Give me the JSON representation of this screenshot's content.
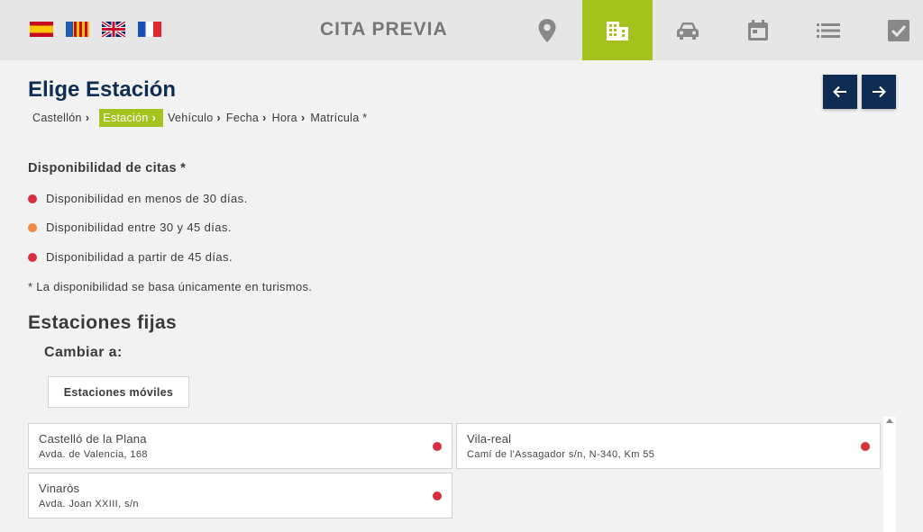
{
  "header": {
    "title": "CITA PREVIA",
    "languages": [
      {
        "code": "es",
        "icon": "spain-flag-icon"
      },
      {
        "code": "va",
        "icon": "valencia-flag-icon"
      },
      {
        "code": "en",
        "icon": "uk-flag-icon"
      },
      {
        "code": "fr",
        "icon": "france-flag-icon"
      }
    ],
    "nav": [
      {
        "icon": "location-pin-icon",
        "active": false
      },
      {
        "icon": "building-icon",
        "active": true
      },
      {
        "icon": "car-icon",
        "active": false
      },
      {
        "icon": "calendar-icon",
        "active": false
      },
      {
        "icon": "list-icon",
        "active": false
      },
      {
        "icon": "checkbox-icon",
        "active": false
      }
    ]
  },
  "page": {
    "title": "Elige Estación"
  },
  "breadcrumb": {
    "items": [
      "Castellón",
      "Estación",
      "Vehículo",
      "Fecha",
      "Hora",
      "Matrícula *"
    ],
    "active_index": 1,
    "separator": "›"
  },
  "availability": {
    "title": "Disponibilidad de citas *",
    "items": [
      {
        "label": "Disponibilidad en menos de 30 días.",
        "color": "#d6303f"
      },
      {
        "label": "Disponibilidad entre 30 y 45 días.",
        "color": "#f18a45"
      },
      {
        "label": "Disponibilidad a partir de 45 días.",
        "color": "#d6303f"
      }
    ],
    "note": "* La disponibilidad se basa únicamente en turismos."
  },
  "stations": {
    "section_title": "Estaciones fijas",
    "change_label": "Cambiar a:",
    "mobile_button": "Estaciones móviles",
    "list": [
      {
        "name": "Castelló de la Plana",
        "address": "Avda. de Valencia, 168",
        "availability_color": "#d6303f"
      },
      {
        "name": "Vila-real",
        "address": "Camí de l'Assagador s/n, N-340, Km 55",
        "availability_color": "#d6303f"
      },
      {
        "name": "Vinaròs",
        "address": "Avda. Joan XXIII, s/n",
        "availability_color": "#d6303f"
      }
    ]
  },
  "colors": {
    "accent": "#a5c31f",
    "navy": "#0f2d52"
  }
}
